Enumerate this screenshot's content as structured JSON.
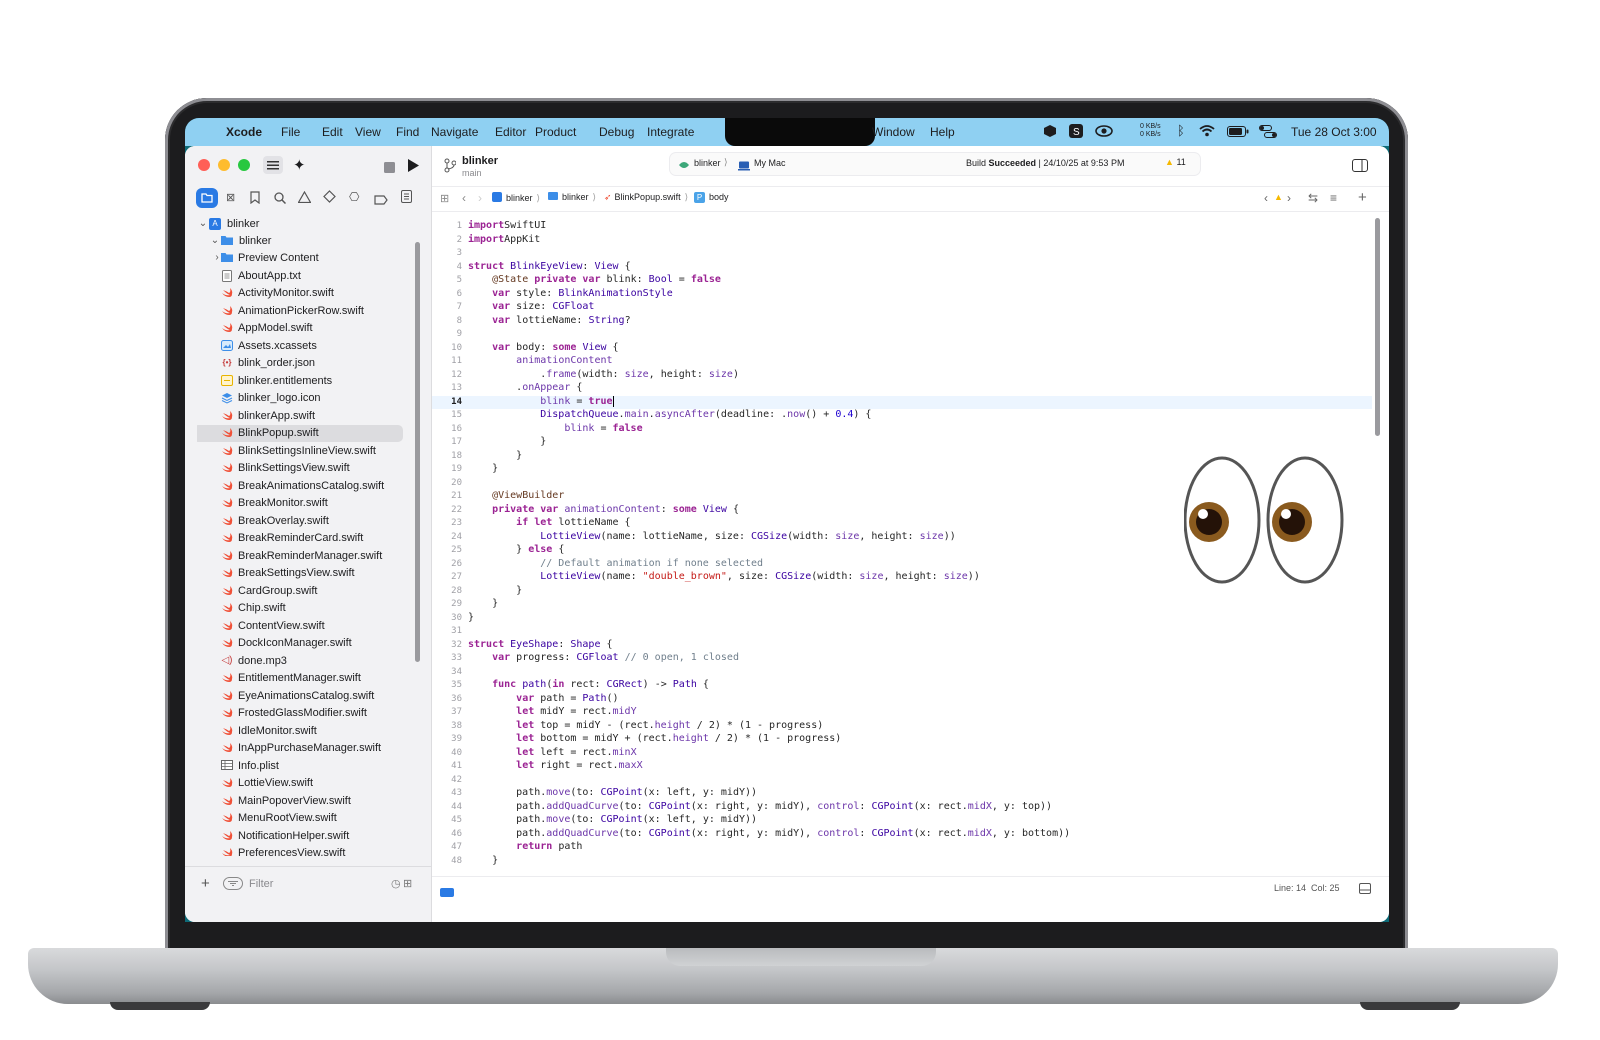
{
  "menubar": {
    "app_name": "Xcode",
    "menus": [
      "File",
      "Edit",
      "View",
      "Find",
      "Navigate",
      "Editor",
      "Product",
      "Debug",
      "Integrate"
    ],
    "menus_right": [
      "Window",
      "Help"
    ],
    "net_up": "0 KB/s",
    "net_down": "0 KB/s",
    "clock": "Tue 28 Oct  3:00"
  },
  "toolbar": {
    "project": "blinker",
    "branch": "main",
    "scheme": "blinker",
    "destination": "My Mac",
    "build_status_prefix": "Build ",
    "build_status_bold": "Succeeded",
    "build_status_suffix": " | 24/10/25 at 9:53 PM",
    "warning_count": "11"
  },
  "breadcrumb": [
    "blinker",
    "blinker",
    "BlinkPopup.swift",
    "body"
  ],
  "navigator": {
    "root": "blinker",
    "group": "blinker",
    "files": [
      {
        "name": "Preview Content",
        "icon": "folder"
      },
      {
        "name": "AboutApp.txt",
        "icon": "text"
      },
      {
        "name": "ActivityMonitor.swift",
        "icon": "swift"
      },
      {
        "name": "AnimationPickerRow.swift",
        "icon": "swift"
      },
      {
        "name": "AppModel.swift",
        "icon": "swift"
      },
      {
        "name": "Assets.xcassets",
        "icon": "assets"
      },
      {
        "name": "blink_order.json",
        "icon": "json"
      },
      {
        "name": "blinker.entitlements",
        "icon": "entitlements"
      },
      {
        "name": "blinker_logo.icon",
        "icon": "icon"
      },
      {
        "name": "blinkerApp.swift",
        "icon": "swift"
      },
      {
        "name": "BlinkPopup.swift",
        "icon": "swift",
        "selected": true
      },
      {
        "name": "BlinkSettingsInlineView.swift",
        "icon": "swift"
      },
      {
        "name": "BlinkSettingsView.swift",
        "icon": "swift"
      },
      {
        "name": "BreakAnimationsCatalog.swift",
        "icon": "swift"
      },
      {
        "name": "BreakMonitor.swift",
        "icon": "swift"
      },
      {
        "name": "BreakOverlay.swift",
        "icon": "swift"
      },
      {
        "name": "BreakReminderCard.swift",
        "icon": "swift"
      },
      {
        "name": "BreakReminderManager.swift",
        "icon": "swift"
      },
      {
        "name": "BreakSettingsView.swift",
        "icon": "swift"
      },
      {
        "name": "CardGroup.swift",
        "icon": "swift"
      },
      {
        "name": "Chip.swift",
        "icon": "swift"
      },
      {
        "name": "ContentView.swift",
        "icon": "swift"
      },
      {
        "name": "DockIconManager.swift",
        "icon": "swift"
      },
      {
        "name": "done.mp3",
        "icon": "audio"
      },
      {
        "name": "EntitlementManager.swift",
        "icon": "swift"
      },
      {
        "name": "EyeAnimationsCatalog.swift",
        "icon": "swift"
      },
      {
        "name": "FrostedGlassModifier.swift",
        "icon": "swift"
      },
      {
        "name": "IdleMonitor.swift",
        "icon": "swift"
      },
      {
        "name": "InAppPurchaseManager.swift",
        "icon": "swift"
      },
      {
        "name": "Info.plist",
        "icon": "plist"
      },
      {
        "name": "LottieView.swift",
        "icon": "swift"
      },
      {
        "name": "MainPopoverView.swift",
        "icon": "swift"
      },
      {
        "name": "MenuRootView.swift",
        "icon": "swift"
      },
      {
        "name": "NotificationHelper.swift",
        "icon": "swift"
      },
      {
        "name": "PreferencesView.swift",
        "icon": "swift"
      }
    ],
    "filter_placeholder": "Filter"
  },
  "editor": {
    "current_line": 14,
    "lines": [
      [
        [
          "kw",
          "import"
        ],
        [
          "",
          "SwiftUI"
        ]
      ],
      [
        [
          "kw",
          "import"
        ],
        [
          "",
          "AppKit"
        ]
      ],
      [],
      [
        [
          "kw",
          "struct"
        ],
        [
          "",
          " "
        ],
        [
          "ty",
          "BlinkEyeView"
        ],
        [
          "",
          ": "
        ],
        [
          "ty",
          "View"
        ],
        [
          "",
          " {"
        ]
      ],
      [
        [
          "",
          "    "
        ],
        [
          "at",
          "@State"
        ],
        [
          "",
          " "
        ],
        [
          "kw",
          "private var"
        ],
        [
          "",
          ""
        ],
        [
          "",
          " blink: "
        ],
        [
          "ty",
          "Bool"
        ],
        [
          "",
          " = "
        ],
        [
          "kw",
          "false"
        ]
      ],
      [
        [
          "",
          "    "
        ],
        [
          "kw",
          "var"
        ],
        [
          "",
          " style: "
        ],
        [
          "ty",
          "BlinkAnimationStyle"
        ]
      ],
      [
        [
          "",
          "    "
        ],
        [
          "kw",
          "var"
        ],
        [
          "",
          " size: "
        ],
        [
          "ty",
          "CGFloat"
        ]
      ],
      [
        [
          "",
          "    "
        ],
        [
          "kw",
          "var"
        ],
        [
          "",
          " lottieName: "
        ],
        [
          "ty",
          "String"
        ],
        [
          "",
          "?"
        ]
      ],
      [],
      [
        [
          "",
          "    "
        ],
        [
          "kw",
          "var"
        ],
        [
          "",
          " body: "
        ],
        [
          "kw",
          "some"
        ],
        [
          "",
          " "
        ],
        [
          "ty",
          "View"
        ],
        [
          "",
          " {"
        ]
      ],
      [
        [
          "",
          "        "
        ],
        [
          "pr",
          "animationContent"
        ]
      ],
      [
        [
          "",
          "            ."
        ],
        [
          "pr",
          "frame"
        ],
        [
          "",
          "(width: "
        ],
        [
          "pr",
          "size"
        ],
        [
          "",
          ", height: "
        ],
        [
          "pr",
          "size"
        ],
        [
          "",
          ")"
        ]
      ],
      [
        [
          "",
          "        ."
        ],
        [
          "pr",
          "onAppear"
        ],
        [
          "",
          " {"
        ]
      ],
      [
        [
          "",
          "            "
        ],
        [
          "pr",
          "blink"
        ],
        [
          "",
          " = "
        ],
        [
          "kw",
          "true"
        ]
      ],
      [
        [
          "",
          "            "
        ],
        [
          "ty",
          "DispatchQueue"
        ],
        [
          "",
          "."
        ],
        [
          "pr",
          "main"
        ],
        [
          "",
          "."
        ],
        [
          "pr",
          "asyncAfter"
        ],
        [
          "",
          "(deadline: ."
        ],
        [
          "pr",
          "now"
        ],
        [
          "",
          "() + "
        ],
        [
          "nu",
          "0.4"
        ],
        [
          "",
          ") {"
        ]
      ],
      [
        [
          "",
          "                "
        ],
        [
          "pr",
          "blink"
        ],
        [
          "",
          " = "
        ],
        [
          "kw",
          "false"
        ]
      ],
      [
        [
          "",
          "            }"
        ]
      ],
      [
        [
          "",
          "        }"
        ]
      ],
      [
        [
          "",
          "    }"
        ]
      ],
      [],
      [
        [
          "",
          "    "
        ],
        [
          "at",
          "@ViewBuilder"
        ]
      ],
      [
        [
          "",
          "    "
        ],
        [
          "kw",
          "private var"
        ],
        [
          "",
          " "
        ],
        [
          "pr",
          "animationContent"
        ],
        [
          "",
          ": "
        ],
        [
          "kw",
          "some"
        ],
        [
          "",
          " "
        ],
        [
          "ty",
          "View"
        ],
        [
          "",
          " {"
        ]
      ],
      [
        [
          "",
          "        "
        ],
        [
          "kw",
          "if let"
        ],
        [
          "",
          " lottieName {"
        ]
      ],
      [
        [
          "",
          "            "
        ],
        [
          "ty",
          "LottieView"
        ],
        [
          "",
          "(name: lottieName, size: "
        ],
        [
          "ty",
          "CGSize"
        ],
        [
          "",
          "(width: "
        ],
        [
          "pr",
          "size"
        ],
        [
          "",
          ", height: "
        ],
        [
          "pr",
          "size"
        ],
        [
          "",
          "))"
        ]
      ],
      [
        [
          "",
          "        } "
        ],
        [
          "kw",
          "else"
        ],
        [
          "",
          " {"
        ]
      ],
      [
        [
          "",
          "            "
        ],
        [
          "cm",
          "// Default animation if none selected"
        ]
      ],
      [
        [
          "",
          "            "
        ],
        [
          "ty",
          "LottieView"
        ],
        [
          "",
          "(name: "
        ],
        [
          "st",
          "\"double_brown\""
        ],
        [
          "",
          ", size: "
        ],
        [
          "ty",
          "CGSize"
        ],
        [
          "",
          "(width: "
        ],
        [
          "pr",
          "size"
        ],
        [
          "",
          ", height: "
        ],
        [
          "pr",
          "size"
        ],
        [
          "",
          "))"
        ]
      ],
      [
        [
          "",
          "        }"
        ]
      ],
      [
        [
          "",
          "    }"
        ]
      ],
      [
        [
          "",
          "}"
        ]
      ],
      [],
      [
        [
          "kw",
          "struct"
        ],
        [
          "",
          " "
        ],
        [
          "ty",
          "EyeShape"
        ],
        [
          "",
          ": "
        ],
        [
          "ty",
          "Shape"
        ],
        [
          "",
          " {"
        ]
      ],
      [
        [
          "",
          "    "
        ],
        [
          "kw",
          "var"
        ],
        [
          "",
          " progress: "
        ],
        [
          "ty",
          "CGFloat"
        ],
        [
          "",
          " "
        ],
        [
          "cm",
          "// 0 open, 1 closed"
        ]
      ],
      [],
      [
        [
          "",
          "    "
        ],
        [
          "kw",
          "func"
        ],
        [
          "",
          " "
        ],
        [
          "ty",
          "path"
        ],
        [
          "",
          "("
        ],
        [
          "kw",
          "in"
        ],
        [
          "",
          " rect: "
        ],
        [
          "ty",
          "CGRect"
        ],
        [
          "",
          ") -> "
        ],
        [
          "ty",
          "Path"
        ],
        [
          "",
          " {"
        ]
      ],
      [
        [
          "",
          "        "
        ],
        [
          "kw",
          "var"
        ],
        [
          "",
          " path = "
        ],
        [
          "ty",
          "Path"
        ],
        [
          "",
          "()"
        ]
      ],
      [
        [
          "",
          "        "
        ],
        [
          "kw",
          "let"
        ],
        [
          "",
          " midY = rect."
        ],
        [
          "pr",
          "midY"
        ]
      ],
      [
        [
          "",
          "        "
        ],
        [
          "kw",
          "let"
        ],
        [
          "",
          " top = midY - (rect."
        ],
        [
          "pr",
          "height"
        ],
        [
          "",
          " / 2) * (1 - progress)"
        ]
      ],
      [
        [
          "",
          "        "
        ],
        [
          "kw",
          "let"
        ],
        [
          "",
          " bottom = midY + (rect."
        ],
        [
          "pr",
          "height"
        ],
        [
          "",
          " / 2) * (1 - progress)"
        ]
      ],
      [
        [
          "",
          "        "
        ],
        [
          "kw",
          "let"
        ],
        [
          "",
          " left = rect."
        ],
        [
          "pr",
          "minX"
        ]
      ],
      [
        [
          "",
          "        "
        ],
        [
          "kw",
          "let"
        ],
        [
          "",
          " right = rect."
        ],
        [
          "pr",
          "maxX"
        ]
      ],
      [],
      [
        [
          "",
          "        path."
        ],
        [
          "pr",
          "move"
        ],
        [
          "",
          "(to: "
        ],
        [
          "ty",
          "CGPoint"
        ],
        [
          "",
          "(x: left, y: midY))"
        ]
      ],
      [
        [
          "",
          "        path."
        ],
        [
          "pr",
          "addQuadCurve"
        ],
        [
          "",
          "(to: "
        ],
        [
          "ty",
          "CGPoint"
        ],
        [
          "",
          "(x: right, y: midY), "
        ],
        [
          "pr",
          "control"
        ],
        [
          "",
          ": "
        ],
        [
          "ty",
          "CGPoint"
        ],
        [
          "",
          "(x: rect."
        ],
        [
          "pr",
          "midX"
        ],
        [
          "",
          ", y: top))"
        ]
      ],
      [
        [
          "",
          "        path."
        ],
        [
          "pr",
          "move"
        ],
        [
          "",
          "(to: "
        ],
        [
          "ty",
          "CGPoint"
        ],
        [
          "",
          "(x: left, y: midY))"
        ]
      ],
      [
        [
          "",
          "        path."
        ],
        [
          "pr",
          "addQuadCurve"
        ],
        [
          "",
          "(to: "
        ],
        [
          "ty",
          "CGPoint"
        ],
        [
          "",
          "(x: right, y: midY), "
        ],
        [
          "pr",
          "control"
        ],
        [
          "",
          ": "
        ],
        [
          "ty",
          "CGPoint"
        ],
        [
          "",
          "(x: rect."
        ],
        [
          "pr",
          "midX"
        ],
        [
          "",
          ", y: bottom))"
        ]
      ],
      [
        [
          "",
          "        "
        ],
        [
          "kw",
          "return"
        ],
        [
          "",
          " path"
        ]
      ],
      [
        [
          "",
          "    }"
        ]
      ]
    ]
  },
  "statusbar": {
    "position": "Line: 14  Col: 25"
  },
  "colors": {
    "menubar": "#8fd0f2",
    "accent": "#2a7ae4",
    "swift_icon": "#f05138",
    "warning": "#f5b800"
  }
}
